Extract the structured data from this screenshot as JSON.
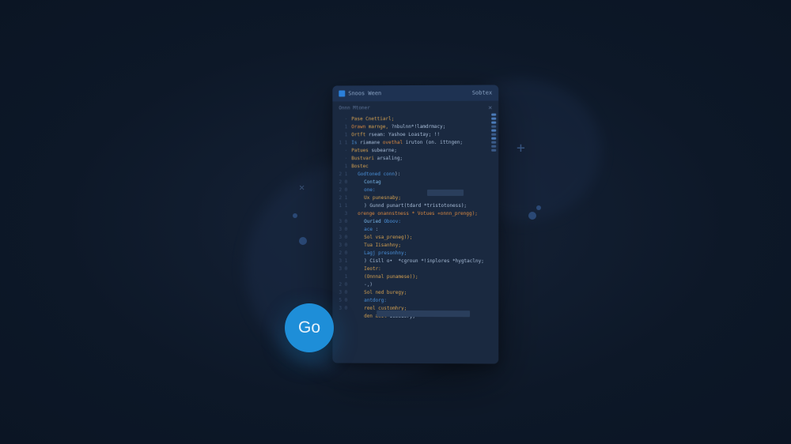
{
  "badge": {
    "label": "Go"
  },
  "editor": {
    "title": "Snoos Ween",
    "right_label": "Sobtex",
    "subtitle": "Onnn Mtoner",
    "gutter": [
      "·",
      "1",
      "1",
      "1 1",
      "·",
      "·",
      "1",
      "2 1",
      "2 0",
      "2 0",
      "2 1",
      "1 1",
      "3",
      "3 0",
      "3 0",
      "3 0",
      "3 0",
      "2 0",
      "3 1",
      "3 0",
      "1",
      "2 0",
      "3 0",
      "5 0",
      "3 0"
    ],
    "lines": [
      {
        "h": "<span class='gold'>Pase Cnettiarl;</span>"
      },
      {
        "h": "<span class='orange'>Orawn</span> <span class='gold'>marnge,</span> <span class='id'>?nbulnn</span><span class='id'>*!lamdrmacy;</span>"
      },
      {
        "h": "<span class='gold'>Ortft</span> <span class='id'>rseam: Yashoe</span> <span class='id'>Loastay;</span> <span class='id'>!!</span>"
      },
      {
        "h": "<span class='blue'>Is</span> <span class='id'>riamane</span> <span class='orange'>ovethal</span> <span class='id'>iruton</span> <span class='id'>(on. ittngen;</span>"
      },
      {
        "h": "<span class='gold'>Patues</span> <span class='id'>subearne;</span>"
      },
      {
        "h": "<span class='gold'>Bustvari</span> <span class='id'>arsaling;</span>"
      },
      {
        "h": "<span class='gold'>Bostec</span>"
      },
      {
        "h": "<span class='blue'>Godtoned conn</span><span class='id'>):</span>",
        "indent": 1
      },
      {
        "h": "<span class='lblue'>Contag</span>",
        "indent": 2
      },
      {
        "h": "<span class='blue'>one:</span>",
        "indent": 2
      },
      {
        "h": "<span class='gold'>Ux punesnaby;</span>",
        "indent": 2
      },
      {
        "h": "<span class='id'>) Gunnd punart(tdard *tristotoness);</span>",
        "indent": 2
      },
      {
        "h": "<span class='orange'>orenge onannstness *</span> <span class='orange'>Votues «onnn_prengg);</span>",
        "indent": 1
      },
      {
        "h": "<span class='lblue'>Ouried</span> <span class='blue'>Oboov:</span>",
        "indent": 2
      },
      {
        "h": "<span class='blue'>ace</span> <span class='id'>:</span>",
        "indent": 2
      },
      {
        "h": "<span class='gold'>Sol vsa_preneg));</span>",
        "indent": 2
      },
      {
        "h": "<span class='gold'>Tua Iisanhny;</span>",
        "indent": 2
      },
      {
        "h": "<span class='blue'>Lagj presonhny;</span>",
        "indent": 2
      },
      {
        "h": "<span class='id'>) Cisll o•  *cgroun *!inplores *hygtaclny;</span>",
        "indent": 2
      },
      {
        "h": "<span class='gold'>Ieotr:</span>",
        "indent": 2
      },
      {
        "h": "<span class='gold'>(Onnnal punamese));</span>",
        "indent": 2
      },
      {
        "h": "<span class='id'>-,)</span>",
        "indent": 2
      },
      {
        "h": "<span class='gold'>Sol ned buregy;</span>",
        "indent": 2
      },
      {
        "h": "<span class='blue'>antdorg:</span>",
        "indent": 2
      },
      {
        "h": "<span class='gold'>reel customhry;</span>",
        "indent": 2
      },
      {
        "h": "<span class='gold'>den acil</span> <span class='id'>Iimedory;</span>",
        "indent": 2
      }
    ]
  }
}
